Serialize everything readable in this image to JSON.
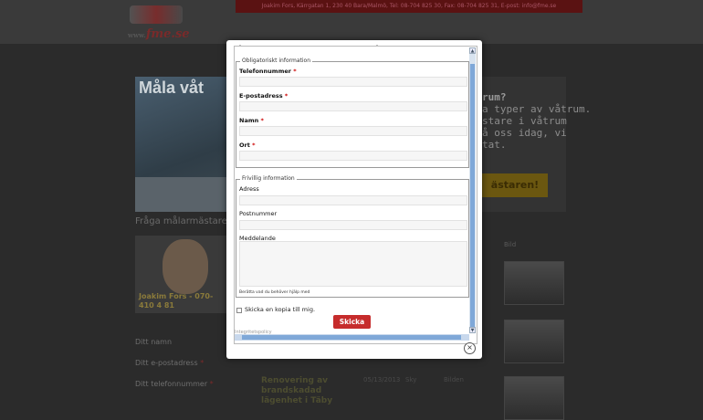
{
  "header": {
    "logo_brand": "fme.se",
    "logo_small": "www.",
    "contact_bar": "Joakim Fors, Kärrgatan 1, 230 40 Bara/Malmö, Tel: 08-704 825 30, Fax: 08-704 825 31, E-post: info@fme.se"
  },
  "hero": {
    "title": "Måla våt"
  },
  "sidebar": {
    "ask_title": "Fråga målarmästaren",
    "person_caption": "Joakim Fors - 070-410 4 81",
    "form_fields": [
      {
        "label": "Ditt namn",
        "required": ""
      },
      {
        "label": "Ditt e-postadress",
        "required": "*"
      },
      {
        "label": "Ditt telefonnummer",
        "required": "*"
      }
    ]
  },
  "promo": {
    "lines": [
      "rum?",
      "a typer av våtrum.",
      "stare i våtrum",
      "å oss idag, vi",
      "tat."
    ],
    "button": "ästaren!"
  },
  "articles": {
    "bild_label": "Bild",
    "first_title": "Renovering av brandskadad lägenhet i Täby",
    "first_date": "05/13/2013",
    "first_category": "Sky",
    "first_extra": "Bilden"
  },
  "modal": {
    "required_legend": "Obligatoriskt information",
    "required_fields": [
      {
        "label": "Telefonnummer",
        "req": "*"
      },
      {
        "label": "E-postadress",
        "req": "*"
      },
      {
        "label": "Namn",
        "req": "*"
      },
      {
        "label": "Ort",
        "req": "*"
      }
    ],
    "optional_legend": "Frivillig information",
    "optional_fields": [
      {
        "label": "Adress"
      },
      {
        "label": "Postnummer"
      },
      {
        "label": "Meddelande"
      }
    ],
    "message_hint": "Berätta vad du behöver hjälp med",
    "copy_label": "Skicka en kopia till mig.",
    "submit_label": "Skicka",
    "integrity_link": "Integritetspolicy",
    "close_icon": "×"
  },
  "colors": {
    "submit": "#c62c2c",
    "scroll": "#7fa8d8",
    "required": "#cc0000"
  }
}
